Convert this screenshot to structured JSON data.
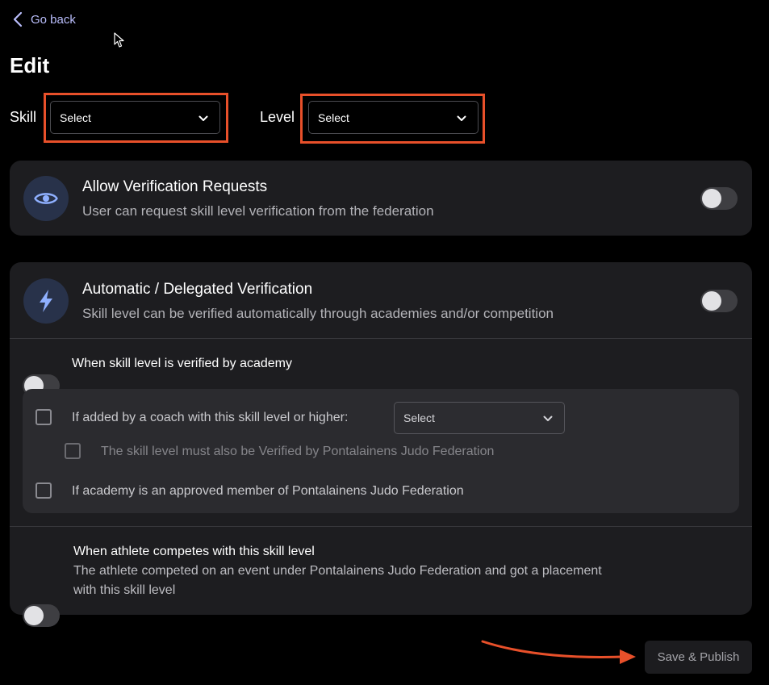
{
  "nav": {
    "back_label": "Go back"
  },
  "page": {
    "title": "Edit"
  },
  "filters": {
    "skill": {
      "label": "Skill",
      "value": "Select"
    },
    "level": {
      "label": "Level",
      "value": "Select"
    }
  },
  "verification_requests": {
    "title": "Allow Verification Requests",
    "subtitle": "User can request skill level verification from the federation",
    "enabled": false
  },
  "automatic_verification": {
    "title": "Automatic / Delegated Verification",
    "subtitle": "Skill level can be verified automatically through academies and/or competition",
    "enabled": false,
    "academy": {
      "label": "When skill level is verified by academy",
      "enabled": false,
      "options": {
        "coach": {
          "label": "If added by a coach with this skill level or higher:",
          "select_value": "Select",
          "checked": false
        },
        "federation_verified": {
          "label": "The skill level must also be Verified by Pontalainens Judo Federation",
          "checked": false
        },
        "approved_member": {
          "label": "If academy is an approved member of Pontalainens Judo Federation",
          "checked": false
        }
      }
    },
    "competition": {
      "title": "When athlete competes with this skill level",
      "description": "The athlete competed on an event under Pontalainens Judo Federation and got a placement with this skill level",
      "enabled": false
    }
  },
  "actions": {
    "save_label": "Save & Publish"
  },
  "colors": {
    "highlight": "#e8502a",
    "accent": "#b9bdfb",
    "icon_accent": "#8fb0ff",
    "background": "#000000",
    "card": "#1d1d20"
  },
  "icons": {
    "back": "chevron-left-icon",
    "visibility": "eye-icon",
    "automatic": "lightning-bolt-icon",
    "dropdown": "chevron-down-icon",
    "pointer": "mouse-cursor-icon"
  }
}
